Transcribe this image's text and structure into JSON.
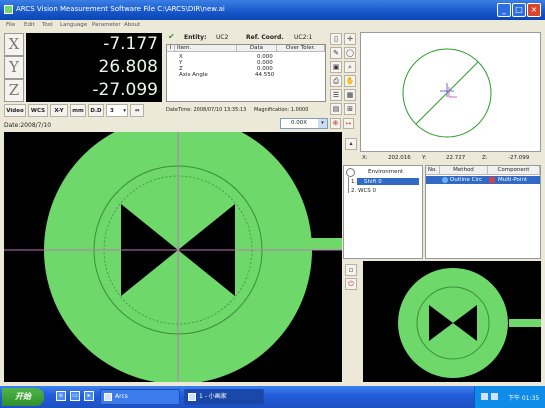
{
  "window": {
    "title": "ARCS Vision Measurement Software    File C:\\ARCS\\DIR\\new.ai",
    "buttons": {
      "minimize": "_",
      "maximize": "□",
      "close": "×"
    }
  },
  "menu": [
    "File",
    "Edit",
    "Tool",
    "Language",
    "Parameter",
    "About"
  ],
  "dro": {
    "x": {
      "label": "X",
      "value": "-7.177"
    },
    "y": {
      "label": "Y",
      "value": "26.808"
    },
    "z": {
      "label": "Z",
      "value": "-27.099"
    }
  },
  "video_toolbar": {
    "video": "Video",
    "wcs": "WCS",
    "xy": "X-Y",
    "mm": "mm",
    "dd": "D.D",
    "digits": "3",
    "digits_arrow": "▾",
    "link": "⇔"
  },
  "date_line": "Date:2008/7/10",
  "entity": {
    "check": "✔",
    "entity_label": "Entity:",
    "entity_value": "UC2",
    "ref_label": "Ref. Coord.",
    "ref_value": "UC2:1",
    "columns": [
      "I",
      "Item.",
      "Data",
      "Over Toler."
    ],
    "rows": [
      {
        "item": "X",
        "data": "0.000"
      },
      {
        "item": "Y",
        "data": "0.000"
      },
      {
        "item": "Z",
        "data": "0.000"
      },
      {
        "item": "Axis Angle",
        "data": "44.550"
      }
    ],
    "datetime_label": "DateTime:",
    "datetime_value": "2008/07/10 13:35:13",
    "magnification_label": "Magnification:",
    "magnification_value": "1.0000"
  },
  "unit_select": {
    "value": "0.00X",
    "arrow": "▾"
  },
  "coordinates": {
    "x_label": "X:",
    "x_value": "202.016",
    "y_label": "Y:",
    "y_value": "22.727",
    "z_label": "Z:",
    "z_value": "-27.099"
  },
  "feature_tree": {
    "root": "Environment",
    "items": [
      {
        "index": "1.",
        "label": "Shift 0",
        "selected": true
      },
      {
        "index": "2.",
        "label": "WCS 0",
        "selected": false
      }
    ]
  },
  "feature_table": {
    "columns": [
      "No.",
      "Method",
      "Component"
    ],
    "row": {
      "no": "",
      "method": "Outline Circ",
      "component": "Multi-Point"
    }
  },
  "taskbar": {
    "start": "开始",
    "tasks": [
      {
        "label": "Arcs"
      },
      {
        "label": "1 - 小画家"
      }
    ],
    "clock": "下午 01:35"
  },
  "colors": {
    "title_bar": "#1656c9",
    "dro_background": "#000000",
    "dro_text": "#e8f7e8",
    "part_green": "#6fd86b",
    "crosshair": "#c06fc0",
    "selection": "#316ac5"
  },
  "icons": [
    "check-icon",
    "search-icon",
    "zoom-icon",
    "save-icon",
    "print-icon",
    "calculator-icon",
    "arrow-icon"
  ]
}
